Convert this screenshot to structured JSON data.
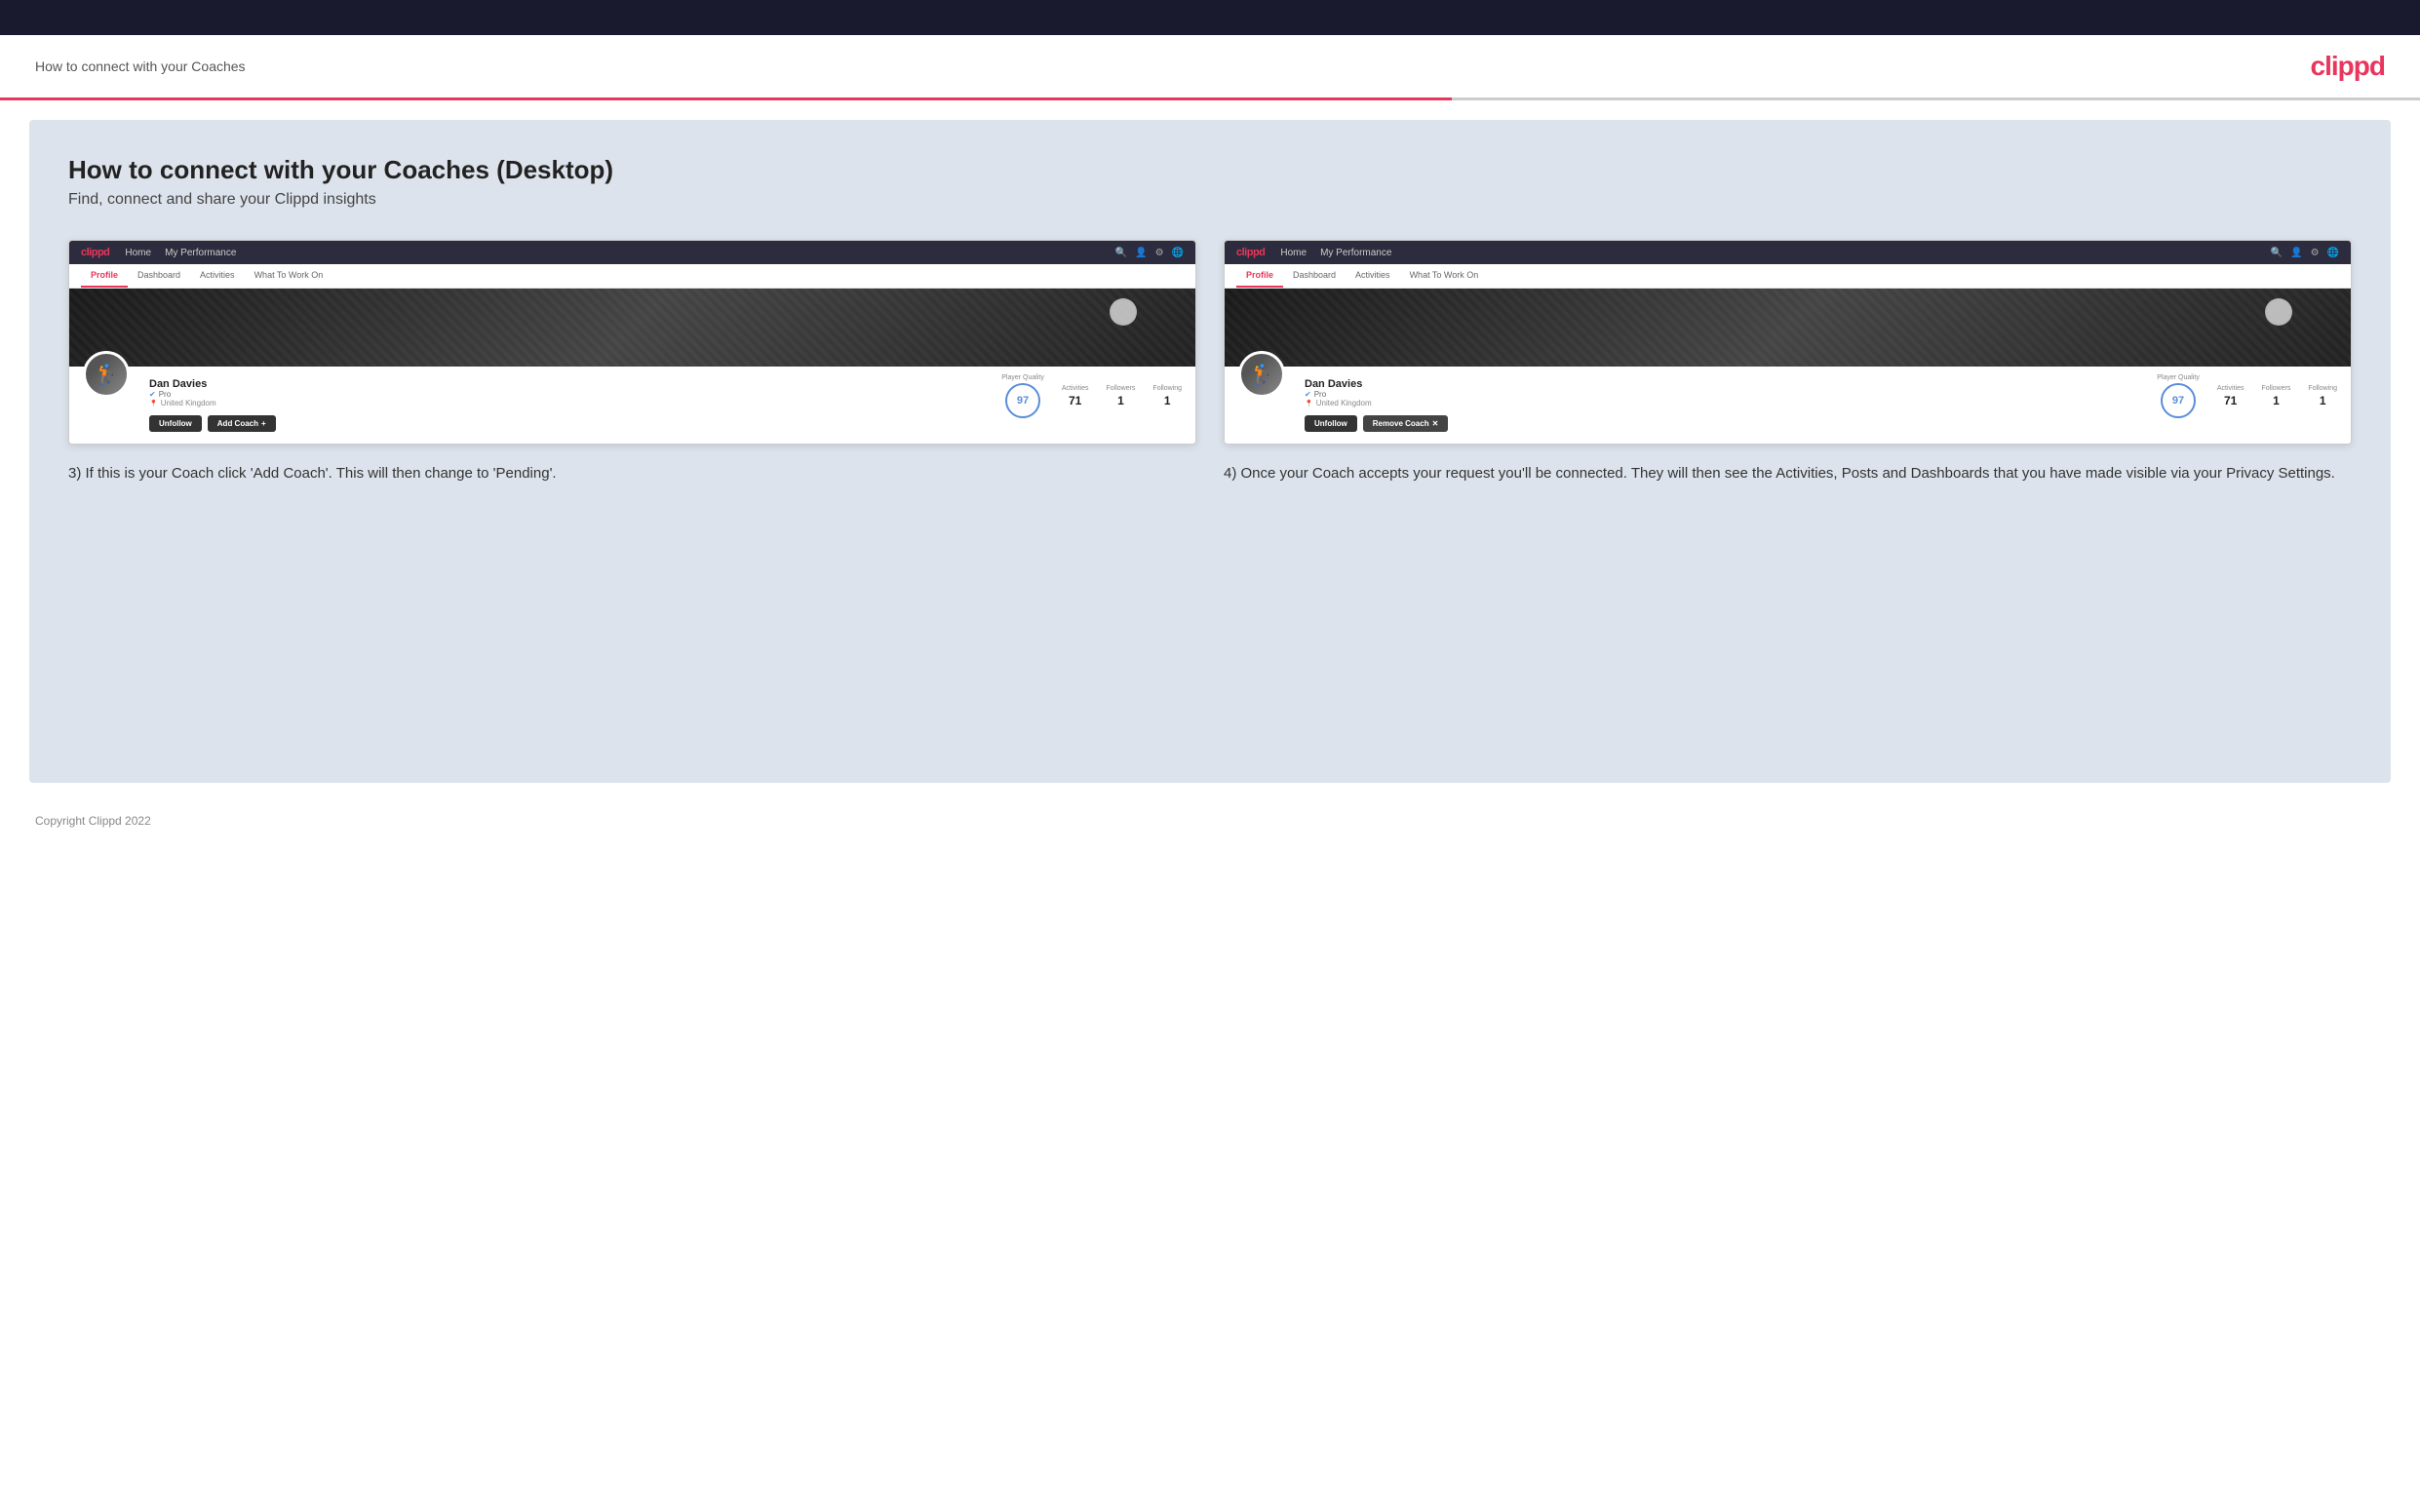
{
  "topbar": {},
  "header": {
    "title": "How to connect with your Coaches",
    "logo": "clippd"
  },
  "main": {
    "page_title": "How to connect with your Coaches (Desktop)",
    "page_subtitle": "Find, connect and share your Clippd insights",
    "step3": {
      "description": "3) If this is your Coach click 'Add Coach'. This will then change to 'Pending'."
    },
    "step4": {
      "description": "4) Once your Coach accepts your request you'll be connected. They will then see the Activities, Posts and Dashboards that you have made visible via your Privacy Settings."
    },
    "screenshot_left": {
      "navbar": {
        "logo": "clippd",
        "nav_items": [
          "Home",
          "My Performance"
        ]
      },
      "tabs": [
        "Profile",
        "Dashboard",
        "Activities",
        "What To Work On"
      ],
      "active_tab": "Profile",
      "profile": {
        "name": "Dan Davies",
        "role": "Pro",
        "location": "United Kingdom",
        "player_quality": 97,
        "activities": 71,
        "followers": 1,
        "following": 1
      },
      "buttons": {
        "unfollow": "Unfollow",
        "add_coach": "Add Coach"
      },
      "stats": {
        "player_quality_label": "Player Quality",
        "activities_label": "Activities",
        "followers_label": "Followers",
        "following_label": "Following"
      }
    },
    "screenshot_right": {
      "navbar": {
        "logo": "clippd",
        "nav_items": [
          "Home",
          "My Performance"
        ]
      },
      "tabs": [
        "Profile",
        "Dashboard",
        "Activities",
        "What To Work On"
      ],
      "active_tab": "Profile",
      "profile": {
        "name": "Dan Davies",
        "role": "Pro",
        "location": "United Kingdom",
        "player_quality": 97,
        "activities": 71,
        "followers": 1,
        "following": 1
      },
      "buttons": {
        "unfollow": "Unfollow",
        "remove_coach": "Remove Coach"
      },
      "stats": {
        "player_quality_label": "Player Quality",
        "activities_label": "Activities",
        "followers_label": "Followers",
        "following_label": "Following"
      }
    }
  },
  "footer": {
    "copyright": "Copyright Clippd 2022"
  }
}
